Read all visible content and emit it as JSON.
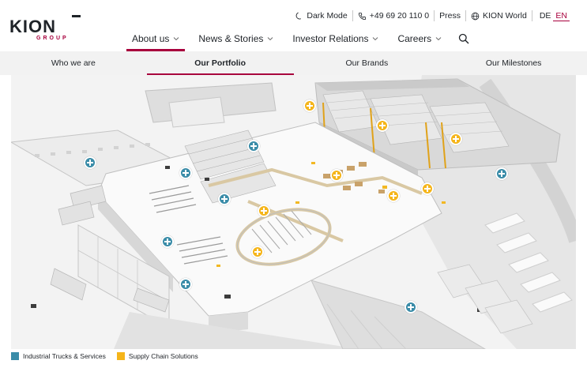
{
  "brand": {
    "wordmark": "KION",
    "subline": "GROUP"
  },
  "utility": {
    "dark_mode": "Dark Mode",
    "phone": "+49 69 20 110 0",
    "press": "Press",
    "world": "KION World",
    "languages": [
      {
        "code": "DE",
        "active": false
      },
      {
        "code": "EN",
        "active": true
      }
    ]
  },
  "mainnav": {
    "items": [
      {
        "label": "About us",
        "active": true
      },
      {
        "label": "News & Stories",
        "active": false
      },
      {
        "label": "Investor Relations",
        "active": false
      },
      {
        "label": "Careers",
        "active": false
      }
    ]
  },
  "subnav": {
    "tabs": [
      {
        "label": "Who we are",
        "active": false
      },
      {
        "label": "Our Portfolio",
        "active": true
      },
      {
        "label": "Our Brands",
        "active": false
      },
      {
        "label": "Our Milestones",
        "active": false
      }
    ]
  },
  "hotspots": {
    "industrial_trucks_count": 8,
    "supply_chain_count": 9
  },
  "legend": {
    "items": [
      {
        "label": "Industrial Trucks & Services",
        "color": "#3a8ca8"
      },
      {
        "label": "Supply Chain Solutions",
        "color": "#f5b51a"
      }
    ]
  },
  "colors": {
    "accent": "#a8003d",
    "blue": "#3a8ca8",
    "yellow": "#f5b51a"
  }
}
